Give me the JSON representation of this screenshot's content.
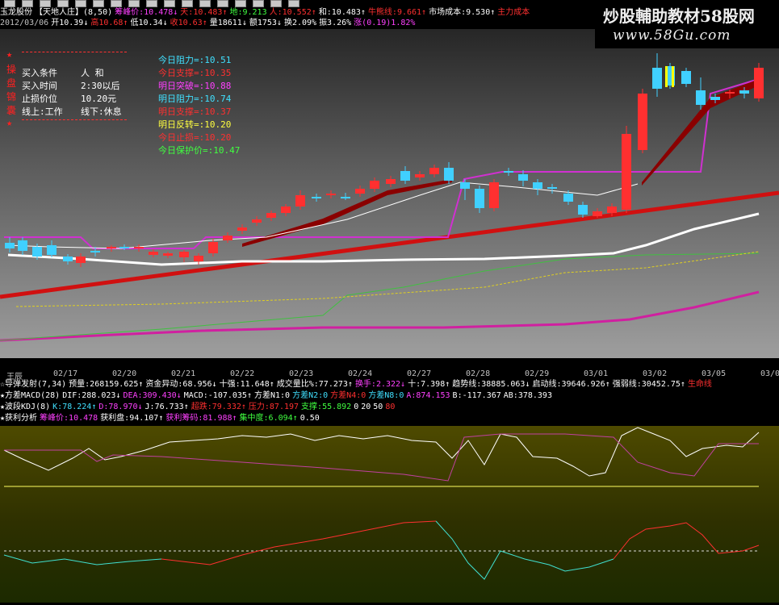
{
  "colors": {
    "up": "#ff3030",
    "down": "#40d0ff",
    "accent": "#ff00ff",
    "yellow": "#ffff40",
    "green": "#40ff40"
  },
  "toolbar": {
    "button_count": 17
  },
  "header1": [
    {
      "t": "玉龙股份",
      "c": "#ffffff"
    },
    {
      "t": "【天地人庄】(8,50)",
      "c": "#ffffff"
    },
    {
      "t": "筹峰价:10.478↓",
      "c": "#ff40ff"
    },
    {
      "t": "天:10.483↑",
      "c": "#ff3030"
    },
    {
      "t": "地:9.213",
      "c": "#40ff40"
    },
    {
      "t": "人:10.552↑",
      "c": "#ff3030"
    },
    {
      "t": "和:10.483↑",
      "c": "#ffffff"
    },
    {
      "t": "牛熊线:9.661↑",
      "c": "#ff3030"
    },
    {
      "t": "市场成本:9.530↑",
      "c": "#ffffff"
    },
    {
      "t": "主力成本",
      "c": "#ff3030"
    }
  ],
  "header2": [
    {
      "t": "2012/03/06",
      "c": "#c0c0c0"
    },
    {
      "t": "开10.39↓",
      "c": "#ffffff"
    },
    {
      "t": "高10.68↑",
      "c": "#ff3030"
    },
    {
      "t": "低10.34↓",
      "c": "#ffffff"
    },
    {
      "t": "收10.63↑",
      "c": "#ff3030"
    },
    {
      "t": "量18611↓",
      "c": "#ffffff"
    },
    {
      "t": "额1753↓",
      "c": "#ffffff"
    },
    {
      "t": "换2.09%",
      "c": "#ffffff"
    },
    {
      "t": "振3.26%",
      "c": "#ffffff"
    },
    {
      "t": "涨(0.19)1.82%",
      "c": "#ff40ff"
    }
  ],
  "watermark": {
    "line1": "炒股輔助教材58股网",
    "line2": "www.58Gu.com"
  },
  "left_panel": {
    "stars": [
      "★",
      "操",
      "盘",
      "锦",
      "囊",
      "★"
    ],
    "rows": [
      {
        "l": "买入条件",
        "r": "人  和"
      },
      {
        "l": "买入时间",
        "r": "2:30以后"
      },
      {
        "l": "止损价位",
        "r": "10.20元"
      },
      {
        "l": "线上:工作",
        "r": "线下:休息"
      }
    ]
  },
  "right_panel": [
    {
      "t": "今日阻力=:10.51",
      "c": "#40e0ff"
    },
    {
      "t": "今日支撑=:10.35",
      "c": "#ff3030"
    },
    {
      "t": "明日突破=:10.88",
      "c": "#ff40ff"
    },
    {
      "t": "明日阻力=:10.74",
      "c": "#40e0ff"
    },
    {
      "t": "明日支撑=:10.37",
      "c": "#ff3030"
    },
    {
      "t": "明日反转=:10.20",
      "c": "#ffff40"
    },
    {
      "t": "今日止损=:10.20",
      "c": "#ff3030"
    },
    {
      "t": "今日保护价=:10.47",
      "c": "#40ff40"
    }
  ],
  "dates": {
    "first": "王辰",
    "items": [
      "02/17",
      "02/20",
      "02/21",
      "02/22",
      "02/23",
      "02/24",
      "02/27",
      "02/28",
      "02/29",
      "03/01",
      "03/02",
      "03/05",
      "03/0"
    ]
  },
  "ind_rows": [
    [
      {
        "t": "☆导弹发射(7,34)",
        "c": "#ffffff"
      },
      {
        "t": "预量:268159.625↑",
        "c": "#ffffff"
      },
      {
        "t": "资金异动:68.956↓",
        "c": "#ffffff"
      },
      {
        "t": "十强:11.648↑",
        "c": "#ffffff"
      },
      {
        "t": "成交量比%:77.273↑",
        "c": "#ffffff"
      },
      {
        "t": "换手:2.322↓",
        "c": "#ff40ff"
      },
      {
        "t": "十:7.398↑",
        "c": "#ffffff"
      },
      {
        "t": "趋势线:38885.063↓",
        "c": "#ffffff"
      },
      {
        "t": "启动线:39646.926↑",
        "c": "#ffffff"
      },
      {
        "t": "强弱线:30452.75↑",
        "c": "#ffffff"
      },
      {
        "t": "生命线",
        "c": "#ff3030"
      }
    ],
    [
      {
        "t": "★方差MACD(28)",
        "c": "#ffffff"
      },
      {
        "t": "DIF:288.023↓",
        "c": "#ffffff"
      },
      {
        "t": "DEA:309.430↓",
        "c": "#ff40ff"
      },
      {
        "t": "MACD:-107.035↑",
        "c": "#ffffff"
      },
      {
        "t": "方差N1:0",
        "c": "#ffffff"
      },
      {
        "t": "方差N2:0",
        "c": "#40e0ff"
      },
      {
        "t": "方差N4:0",
        "c": "#ff3030"
      },
      {
        "t": "方差N8:0",
        "c": "#40e0ff"
      },
      {
        "t": "A:874.153",
        "c": "#ff40ff"
      },
      {
        "t": "B:-117.367",
        "c": "#ffffff"
      },
      {
        "t": "AB:378.393",
        "c": "#ffffff"
      }
    ],
    [
      {
        "t": "★波段KDJ(8)",
        "c": "#ffffff"
      },
      {
        "t": "K:78.224↑",
        "c": "#40e0ff"
      },
      {
        "t": "D:78.970↓",
        "c": "#ff40ff"
      },
      {
        "t": "J:76.733↑",
        "c": "#ffffff"
      },
      {
        "t": "超跌:79.332↑",
        "c": "#ff3030"
      },
      {
        "t": "压力:87.197",
        "c": "#ff3030"
      },
      {
        "t": "支撑:55.892",
        "c": "#40ff40"
      },
      {
        "t": "0",
        "c": "#ffffff"
      },
      {
        "t": "20",
        "c": "#ffffff"
      },
      {
        "t": "50",
        "c": "#ffffff"
      },
      {
        "t": "80",
        "c": "#ff3030"
      }
    ],
    [
      {
        "t": "★获利分析",
        "c": "#ffffff"
      },
      {
        "t": "筹峰价:10.478",
        "c": "#ff40ff"
      },
      {
        "t": "获利盘:94.107↑",
        "c": "#ffffff"
      },
      {
        "t": "获利筹码:81.988↑",
        "c": "#ff40ff"
      },
      {
        "t": "集中度:6.094↑",
        "c": "#40ff40"
      },
      {
        "t": "0.50",
        "c": "#ffffff"
      }
    ]
  ]
}
